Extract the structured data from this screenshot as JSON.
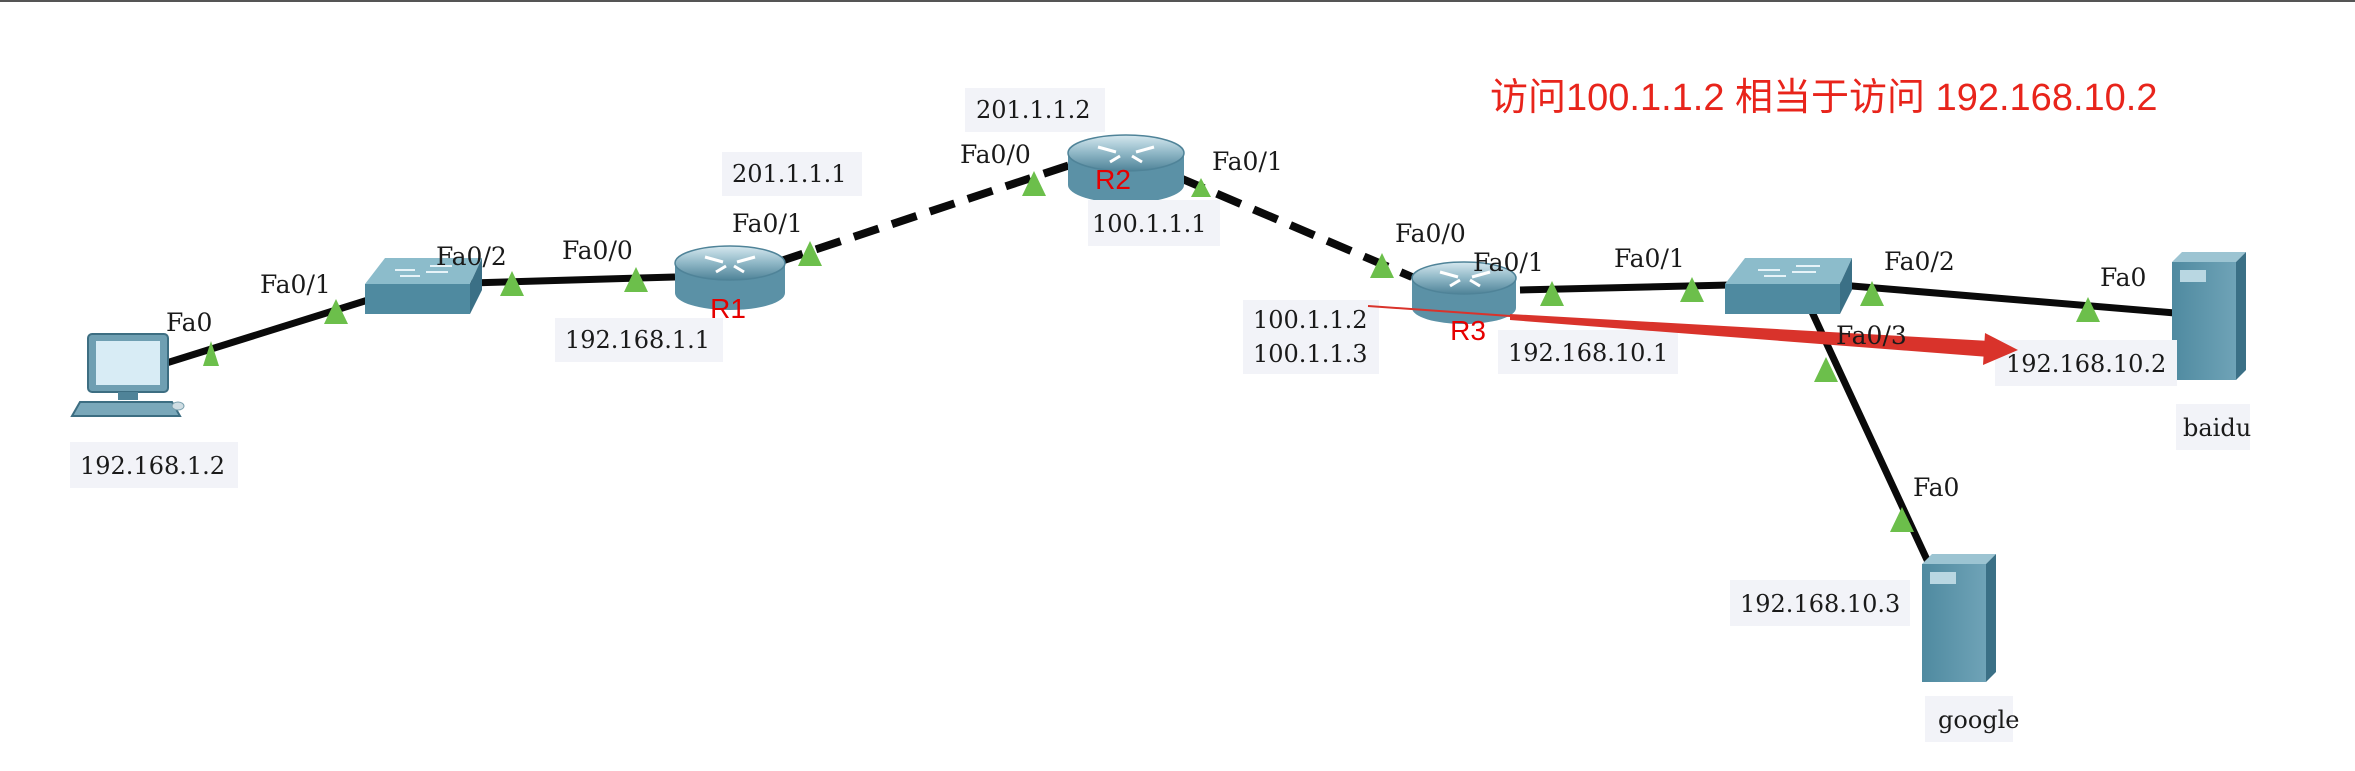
{
  "annotation": "访问100.1.1.2 相当于访问 192.168.10.2",
  "devices": {
    "pc": {
      "ip": "192.168.1.2",
      "port": "Fa0"
    },
    "switch1": {
      "port_pc": "Fa0/1",
      "port_r1": "Fa0/2"
    },
    "r1": {
      "name": "R1",
      "ip_lan": "192.168.1.1",
      "ip_wan": "201.1.1.1",
      "port_lan": "Fa0/0",
      "port_wan": "Fa0/1"
    },
    "r2": {
      "name": "R2",
      "ip_r1": "201.1.1.2",
      "ip_r3": "100.1.1.1",
      "port_r1": "Fa0/0",
      "port_r3": "Fa0/1"
    },
    "r3": {
      "name": "R3",
      "ip_wan_1": "100.1.1.2",
      "ip_wan_2": "100.1.1.3",
      "ip_lan": "192.168.10.1",
      "port_wan": "Fa0/0",
      "port_lan": "Fa0/1"
    },
    "switch2": {
      "port_r3": "Fa0/1",
      "port_baidu": "Fa0/2",
      "port_google": "Fa0/3"
    },
    "baidu": {
      "name": "baidu",
      "ip": "192.168.10.2",
      "port": "Fa0"
    },
    "google": {
      "name": "google",
      "ip": "192.168.10.3",
      "port": "Fa0"
    }
  },
  "colors": {
    "link": "#0a0a0a",
    "port_marker": "#6cbf4b",
    "arrow": "#d9332b",
    "device": "#5c93a8"
  }
}
